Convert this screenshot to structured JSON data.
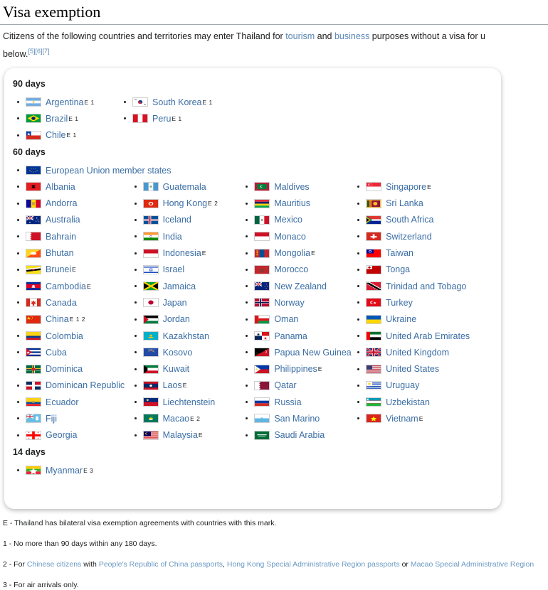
{
  "page": {
    "title": "Visa exemption",
    "intro_parts": {
      "t1": "Citizens of the following countries and territories may enter Thailand for ",
      "l1": "tourism",
      "t2": " and ",
      "l2": "business",
      "t3": " purposes without a visa for u",
      "t4": "below.",
      "refs": "[5][6][7]"
    }
  },
  "sections": [
    {
      "heading": "90 days",
      "columns": [
        {
          "items": [
            {
              "name": "Argentina",
              "sup": "E 1",
              "flag": "ar"
            },
            {
              "name": "Brazil",
              "sup": "E 1",
              "flag": "br"
            },
            {
              "name": "Chile",
              "sup": "E 1",
              "flag": "cl"
            }
          ]
        },
        {
          "items": [
            {
              "name": "South Korea",
              "sup": "E 1",
              "flag": "kr"
            },
            {
              "name": "Peru",
              "sup": "E 1",
              "flag": "pe"
            }
          ]
        }
      ]
    },
    {
      "heading": "60 days",
      "lead": {
        "name": "European Union member states",
        "sup": "",
        "flag": "eu"
      },
      "columns": [
        {
          "items": [
            {
              "name": "Albania",
              "sup": "",
              "flag": "al"
            },
            {
              "name": "Andorra",
              "sup": "",
              "flag": "ad"
            },
            {
              "name": "Australia",
              "sup": "",
              "flag": "au"
            },
            {
              "name": "Bahrain",
              "sup": "",
              "flag": "bh"
            },
            {
              "name": "Bhutan",
              "sup": "",
              "flag": "bt"
            },
            {
              "name": "Brunei",
              "sup": "E",
              "flag": "bn"
            },
            {
              "name": "Cambodia",
              "sup": "E",
              "flag": "kh"
            },
            {
              "name": "Canada",
              "sup": "",
              "flag": "ca"
            },
            {
              "name": "China",
              "sup": "E 1 2",
              "flag": "cn"
            },
            {
              "name": "Colombia",
              "sup": "",
              "flag": "co"
            },
            {
              "name": "Cuba",
              "sup": "",
              "flag": "cu"
            },
            {
              "name": "Dominica",
              "sup": "",
              "flag": "dm"
            },
            {
              "name": "Dominican Republic",
              "sup": "",
              "flag": "do"
            },
            {
              "name": "Ecuador",
              "sup": "",
              "flag": "ec"
            },
            {
              "name": "Fiji",
              "sup": "",
              "flag": "fj"
            },
            {
              "name": "Georgia",
              "sup": "",
              "flag": "ge"
            }
          ]
        },
        {
          "items": [
            {
              "name": "Guatemala",
              "sup": "",
              "flag": "gt"
            },
            {
              "name": "Hong Kong",
              "sup": "E 2",
              "flag": "hk"
            },
            {
              "name": "Iceland",
              "sup": "",
              "flag": "is"
            },
            {
              "name": "India",
              "sup": "",
              "flag": "in"
            },
            {
              "name": "Indonesia",
              "sup": "E",
              "flag": "id"
            },
            {
              "name": "Israel",
              "sup": "",
              "flag": "il"
            },
            {
              "name": "Jamaica",
              "sup": "",
              "flag": "jm"
            },
            {
              "name": "Japan",
              "sup": "",
              "flag": "jp"
            },
            {
              "name": "Jordan",
              "sup": "",
              "flag": "jo"
            },
            {
              "name": "Kazakhstan",
              "sup": "",
              "flag": "kz"
            },
            {
              "name": "Kosovo",
              "sup": "",
              "flag": "xk"
            },
            {
              "name": "Kuwait",
              "sup": "",
              "flag": "kw"
            },
            {
              "name": "Laos",
              "sup": "E",
              "flag": "la"
            },
            {
              "name": "Liechtenstein",
              "sup": "",
              "flag": "li"
            },
            {
              "name": "Macao",
              "sup": "E 2",
              "flag": "mo"
            },
            {
              "name": "Malaysia",
              "sup": "E",
              "flag": "my"
            }
          ]
        },
        {
          "items": [
            {
              "name": "Maldives",
              "sup": "",
              "flag": "mv"
            },
            {
              "name": "Mauritius",
              "sup": "",
              "flag": "mu"
            },
            {
              "name": "Mexico",
              "sup": "",
              "flag": "mx"
            },
            {
              "name": "Monaco",
              "sup": "",
              "flag": "mc"
            },
            {
              "name": "Mongolia",
              "sup": "E",
              "flag": "mn"
            },
            {
              "name": "Morocco",
              "sup": "",
              "flag": "ma"
            },
            {
              "name": "New Zealand",
              "sup": "",
              "flag": "nz"
            },
            {
              "name": "Norway",
              "sup": "",
              "flag": "no"
            },
            {
              "name": "Oman",
              "sup": "",
              "flag": "om"
            },
            {
              "name": "Panama",
              "sup": "",
              "flag": "pa"
            },
            {
              "name": "Papua New Guinea",
              "sup": "",
              "flag": "pg"
            },
            {
              "name": "Philippines",
              "sup": "E",
              "flag": "ph"
            },
            {
              "name": "Qatar",
              "sup": "",
              "flag": "qa"
            },
            {
              "name": "Russia",
              "sup": "",
              "flag": "ru"
            },
            {
              "name": "San Marino",
              "sup": "",
              "flag": "sm"
            },
            {
              "name": "Saudi Arabia",
              "sup": "",
              "flag": "sa"
            }
          ]
        },
        {
          "items": [
            {
              "name": "Singapore",
              "sup": "E",
              "flag": "sg"
            },
            {
              "name": "Sri Lanka",
              "sup": "",
              "flag": "lk"
            },
            {
              "name": "South Africa",
              "sup": "",
              "flag": "za"
            },
            {
              "name": "Switzerland",
              "sup": "",
              "flag": "ch"
            },
            {
              "name": "Taiwan",
              "sup": "",
              "flag": "tw"
            },
            {
              "name": "Tonga",
              "sup": "",
              "flag": "to"
            },
            {
              "name": "Trinidad and Tobago",
              "sup": "",
              "flag": "tt"
            },
            {
              "name": "Turkey",
              "sup": "",
              "flag": "tr"
            },
            {
              "name": "Ukraine",
              "sup": "",
              "flag": "ua"
            },
            {
              "name": "United Arab Emirates",
              "sup": "",
              "flag": "ae"
            },
            {
              "name": "United Kingdom",
              "sup": "",
              "flag": "gb"
            },
            {
              "name": "United States",
              "sup": "",
              "flag": "us"
            },
            {
              "name": "Uruguay",
              "sup": "",
              "flag": "uy"
            },
            {
              "name": "Uzbekistan",
              "sup": "",
              "flag": "uz"
            },
            {
              "name": "Vietnam",
              "sup": "E",
              "flag": "vn"
            }
          ]
        }
      ]
    },
    {
      "heading": "14 days",
      "columns": [
        {
          "items": [
            {
              "name": "Myanmar",
              "sup": "E 3",
              "flag": "mm"
            }
          ]
        }
      ]
    }
  ],
  "footnotes": {
    "e": "E - Thailand has bilateral visa exemption agreements with countries with this mark.",
    "n1": "1 - No more than 90 days within any 180 days.",
    "n2_pre": "2 - For ",
    "n2_l1": "Chinese citizens",
    "n2_mid1": " with ",
    "n2_l2": "People's Republic of China passports",
    "n2_mid2": ", ",
    "n2_l3": "Hong Kong Special Administrative Region passports",
    "n2_mid3": " or ",
    "n2_l4": "Macao Special Administrative Region",
    "n3": "3 - For air arrivals only."
  },
  "colors": {
    "link": "#3b6ea5",
    "rule": "#a2a9b1",
    "text": "#202122"
  }
}
